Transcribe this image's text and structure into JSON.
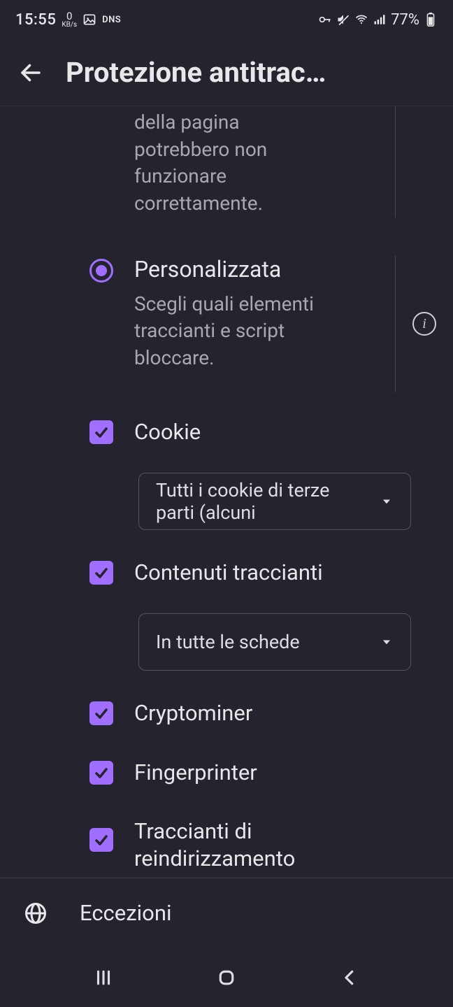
{
  "status_bar": {
    "time": "15:55",
    "net_speed_value": "0",
    "net_speed_unit": "KB/s",
    "dns_label": "DNS",
    "battery_percent": "77%"
  },
  "header": {
    "title": "Protezione antitrac…"
  },
  "previous_option": {
    "description_tail": "della pagina potrebbero non funzionare correttamente."
  },
  "custom_option": {
    "title": "Personalizzata",
    "description": "Scegli quali elementi traccianti e script bloccare.",
    "selected": true
  },
  "settings": {
    "cookie": {
      "label": "Cookie",
      "checked": true,
      "dropdown_value": "Tutti i cookie di terze parti (alcuni"
    },
    "tracking_content": {
      "label": "Contenuti traccianti",
      "checked": true,
      "dropdown_value": "In tutte le schede"
    },
    "cryptominer": {
      "label": "Cryptominer",
      "checked": true
    },
    "fingerprinter": {
      "label": "Fingerprinter",
      "checked": true
    },
    "redirect_trackers": {
      "label": "Traccianti di reindirizzamento",
      "checked": true
    }
  },
  "footer": {
    "label": "Eccezioni"
  },
  "info_glyph": "i",
  "colors": {
    "accent": "#a06fff",
    "background": "#25232d",
    "text_primary": "#e8e8ea",
    "text_secondary": "#a9a7b0"
  }
}
